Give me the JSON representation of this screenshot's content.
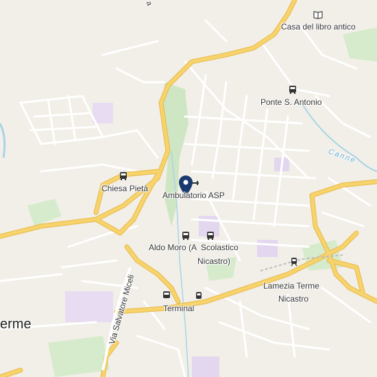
{
  "map": {
    "colors": {
      "land": "#f2efe9",
      "road_major": "#f6d36b",
      "road_major_casing": "#e8b84a",
      "road_minor": "#ffffff",
      "park": "#cfe6c4",
      "water": "#a8d4e6",
      "building_purple": "#e3d7f0",
      "marker": "#1a3a6e"
    },
    "labels": {
      "casa_libro": "Casa del libro antico",
      "ponte": "Ponte S. Antonio",
      "canne": "Canne",
      "chiesa": "Chiesa Pietà",
      "ambulatorio": "Ambulatorio ASP",
      "aldo_moro": "Aldo Moro (A",
      "scolastico": "Scolastico",
      "nicastro_paren": "Nicastro)",
      "lamezia": "Lamezia Terme",
      "nicastro": "Nicastro",
      "terminal": "Terminal",
      "terme": "erme",
      "via_miceli": "Via Salvatore Miceli",
      "road_top": "a"
    },
    "icons": {
      "book": "book-icon",
      "bus": "bus-icon",
      "train": "train-icon",
      "pin": "location-pin-icon",
      "medical": "medical-icon"
    }
  }
}
